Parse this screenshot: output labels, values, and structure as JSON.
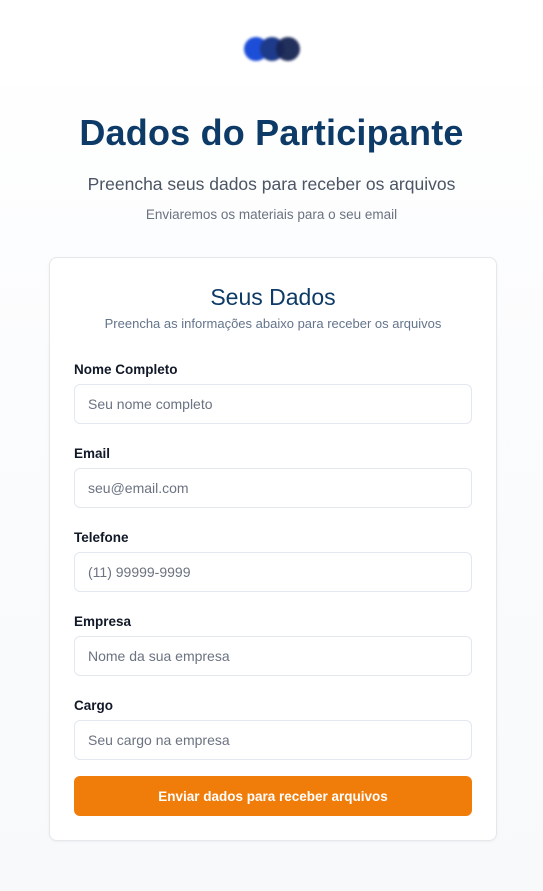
{
  "header": {
    "logo_icon": "three-overlapping-blue-dots-logo"
  },
  "hero": {
    "title": "Dados do Participante",
    "subtitle": "Preencha seus dados para receber os arquivos",
    "note": "Enviaremos os materiais para o seu email"
  },
  "form": {
    "title": "Seus Dados",
    "subtitle": "Preencha as informações abaixo para receber os arquivos",
    "fields": [
      {
        "label": "Nome Completo",
        "placeholder": "Seu nome completo",
        "value": ""
      },
      {
        "label": "Email",
        "placeholder": "seu@email.com",
        "value": ""
      },
      {
        "label": "Telefone",
        "placeholder": "(11) 99999-9999",
        "value": ""
      },
      {
        "label": "Empresa",
        "placeholder": "Nome da sua empresa",
        "value": ""
      },
      {
        "label": "Cargo",
        "placeholder": "Seu cargo na empresa",
        "value": ""
      }
    ],
    "submit_label": "Enviar dados para receber arquivos"
  },
  "colors": {
    "title": "#0d3a66",
    "accent": "#f07c0a",
    "logo_primary": "#1d4ed8",
    "logo_dark": "#172554"
  }
}
